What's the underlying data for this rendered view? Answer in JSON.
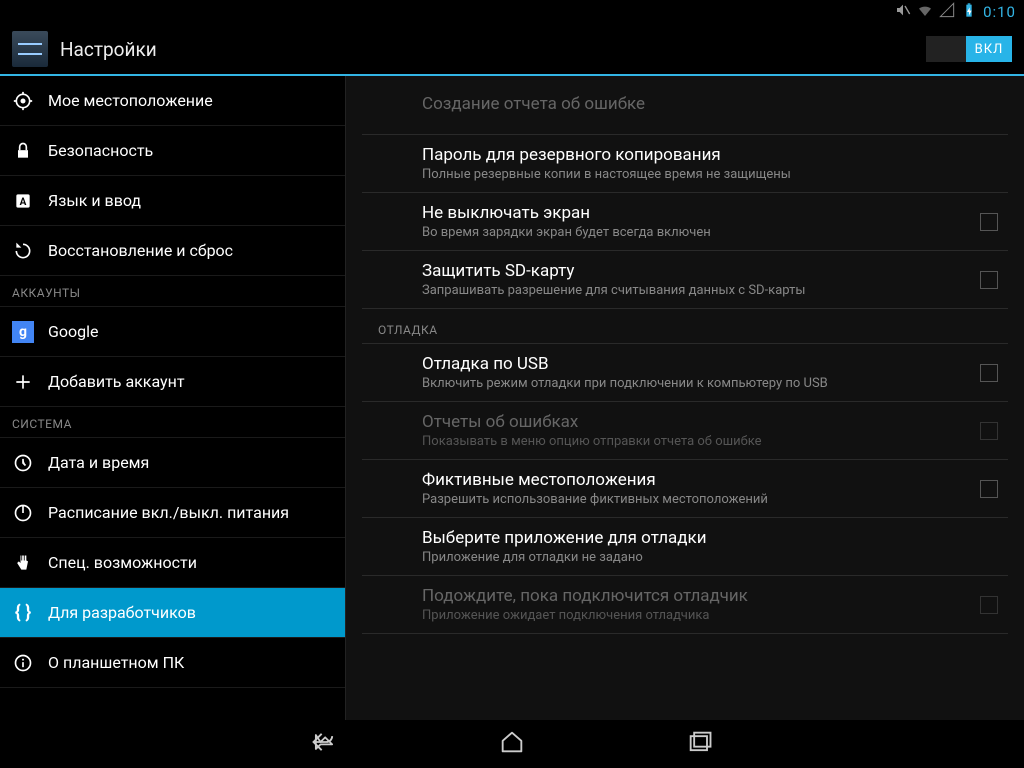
{
  "status": {
    "time": "0:10"
  },
  "header": {
    "title": "Настройки",
    "toggle_on_label": "ВКЛ"
  },
  "sidebar": {
    "items": [
      {
        "label": "Мое местоположение",
        "icon": "target"
      },
      {
        "label": "Безопасность",
        "icon": "lock"
      },
      {
        "label": "Язык и ввод",
        "icon": "language"
      },
      {
        "label": "Восстановление и сброс",
        "icon": "restore"
      }
    ],
    "section_accounts": "АККАУНТЫ",
    "accounts": [
      {
        "label": "Google",
        "icon": "google"
      },
      {
        "label": "Добавить аккаунт",
        "icon": "plus"
      }
    ],
    "section_system": "СИСТЕМА",
    "system": [
      {
        "label": "Дата и время",
        "icon": "clock"
      },
      {
        "label": "Расписание вкл./выкл. питания",
        "icon": "power-sched"
      },
      {
        "label": "Спец. возможности",
        "icon": "hand"
      },
      {
        "label": "Для разработчиков",
        "icon": "braces",
        "selected": true
      },
      {
        "label": "О планшетном ПК",
        "icon": "info"
      }
    ]
  },
  "detail": {
    "items": [
      {
        "title": "Создание отчета об ошибке",
        "subtitle": "",
        "disabled": true,
        "checkbox": false
      },
      {
        "title": "Пароль для резервного копирования",
        "subtitle": "Полные резервные копии в настоящее время не защищены",
        "disabled": false,
        "checkbox": false
      },
      {
        "title": "Не выключать экран",
        "subtitle": "Во время зарядки экран будет всегда включен",
        "disabled": false,
        "checkbox": true
      },
      {
        "title": "Защитить SD-карту",
        "subtitle": "Запрашивать разрешение для считывания данных с SD-карты",
        "disabled": false,
        "checkbox": true
      }
    ],
    "section_debug": "ОТЛАДКА",
    "debug_items": [
      {
        "title": "Отладка по USB",
        "subtitle": "Включить режим отладки при подключении к компьютеру по USB",
        "disabled": false,
        "checkbox": true
      },
      {
        "title": "Отчеты об ошибках",
        "subtitle": "Показывать в меню опцию отправки отчета об ошибке",
        "disabled": true,
        "checkbox": true
      },
      {
        "title": "Фиктивные местоположения",
        "subtitle": "Разрешить использование фиктивных местоположений",
        "disabled": false,
        "checkbox": true
      },
      {
        "title": "Выберите приложение для отладки",
        "subtitle": "Приложение для отладки не задано",
        "disabled": false,
        "checkbox": false
      },
      {
        "title": "Подождите, пока подключится отладчик",
        "subtitle": "Приложение ожидает подключения отладчика",
        "disabled": true,
        "checkbox": true
      }
    ]
  }
}
